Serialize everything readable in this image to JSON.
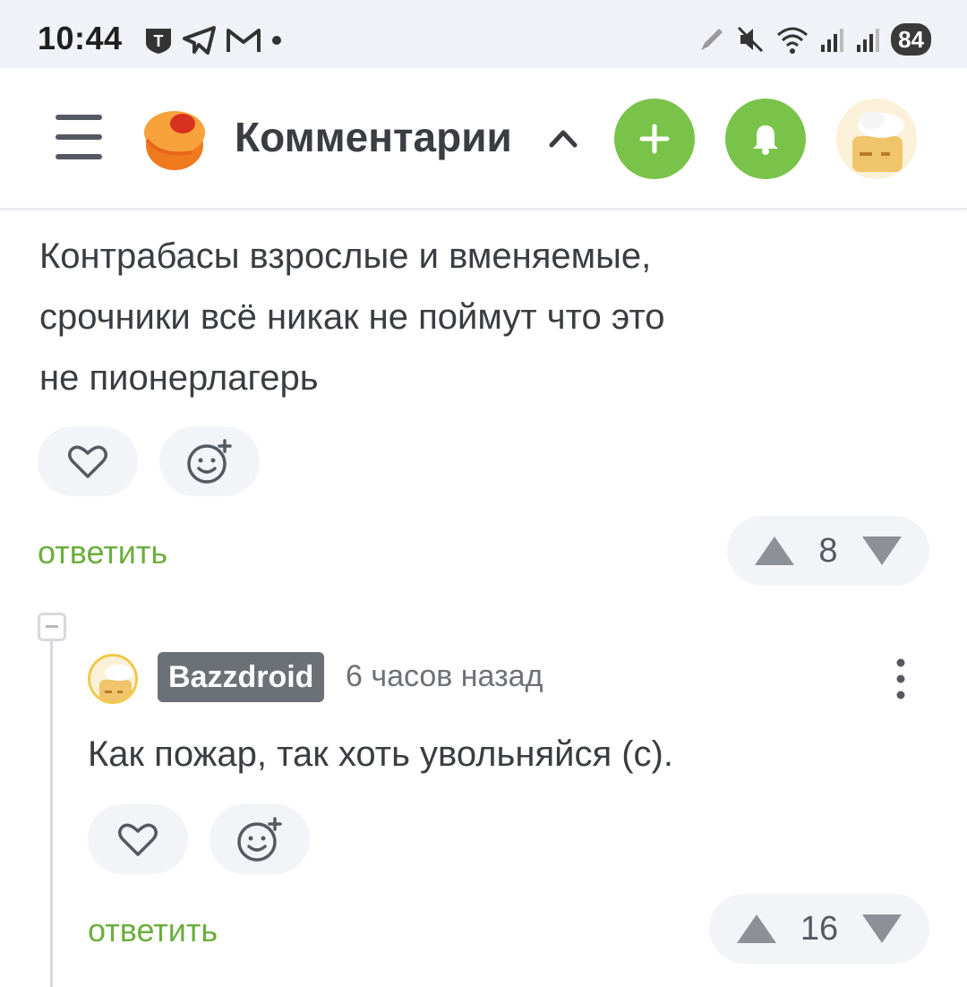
{
  "status_bar": {
    "time": "10:44",
    "battery": "84",
    "left_icons": [
      "tinkoff-icon",
      "telegram-icon",
      "gmail-icon",
      "dot-icon"
    ],
    "right_icons": [
      "pen-icon",
      "mute-icon",
      "wifi-icon",
      "signal-icon",
      "signal-icon"
    ]
  },
  "header": {
    "title": "Комментарии",
    "add_button_icon": "plus-icon",
    "notifications_icon": "bell-icon"
  },
  "comments": [
    {
      "text_lines": [
        "Контрабасы взрослые и вменяемые,",
        "срочники всё никак не поймут что это",
        "не пионерлагерь"
      ],
      "reply_label": "ответить",
      "rating": "8"
    },
    {
      "author": "Bazzdroid",
      "time_ago": "6 часов назад",
      "text": "Как пожар, так хоть увольняйся (с).",
      "reply_label": "ответить",
      "rating": "16"
    }
  ],
  "colors": {
    "accent_green": "#79c34a",
    "reply_green": "#6aae3c",
    "pill_bg": "#f3f4f8",
    "username_bg": "#6c7077"
  }
}
